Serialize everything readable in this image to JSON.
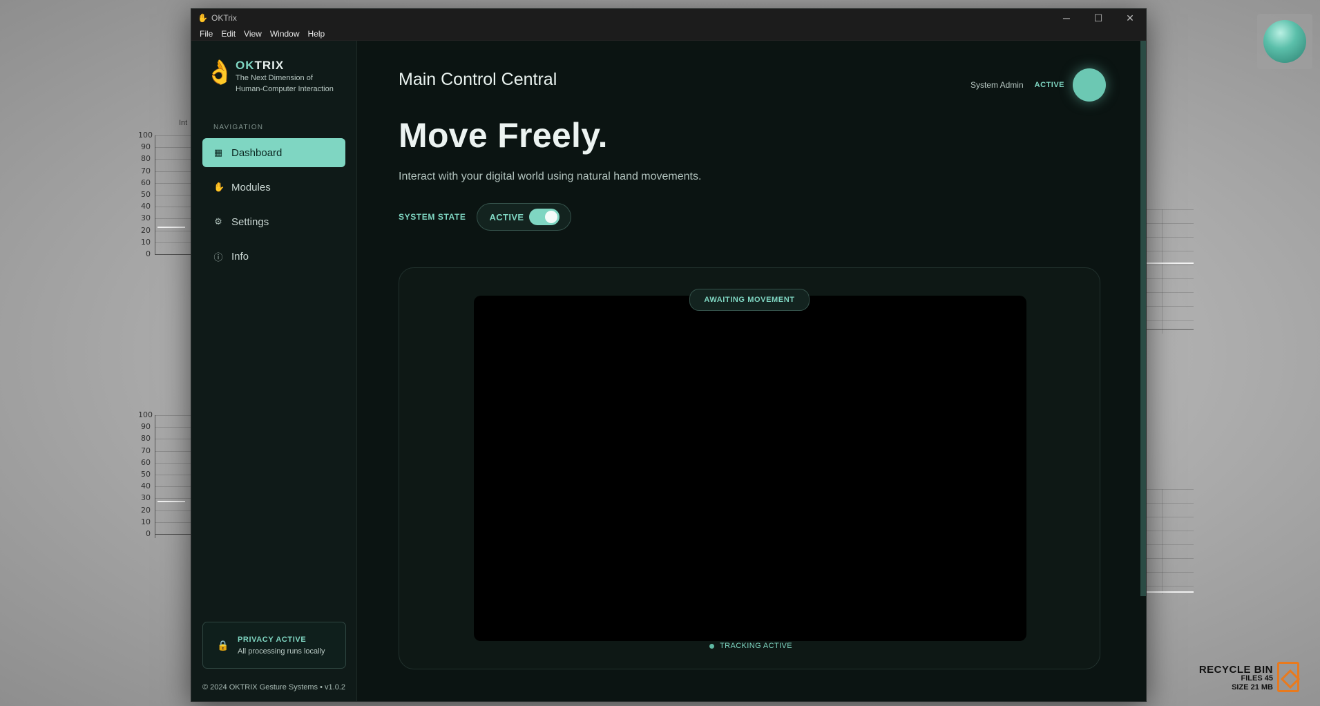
{
  "desktop": {
    "chart1": {
      "title": "Int",
      "yticks": [
        "100",
        "90",
        "80",
        "70",
        "60",
        "50",
        "40",
        "30",
        "20",
        "10",
        "0"
      ]
    },
    "chart2": {
      "yticks": [
        "100",
        "90",
        "80",
        "70",
        "60",
        "50",
        "40",
        "30",
        "20",
        "10",
        "0"
      ]
    },
    "recycle_bin": {
      "title": "RECYCLE BIN",
      "files": "FILES 45",
      "size": "SIZE 21 MB"
    }
  },
  "window": {
    "title": "OKTrix",
    "controls": {
      "minimize": "─",
      "maximize": "☐",
      "close": "✕"
    }
  },
  "menu": [
    "File",
    "Edit",
    "View",
    "Window",
    "Help"
  ],
  "sidebar": {
    "brand": {
      "ok": "OK",
      "trix": "TRIX",
      "tagline1": "The Next Dimension of",
      "tagline2": "Human-Computer Interaction"
    },
    "nav_heading": "NAVIGATION",
    "items": [
      {
        "label": "Dashboard",
        "icon": "grid-icon",
        "glyph": "▦"
      },
      {
        "label": "Modules",
        "icon": "hand-icon",
        "glyph": "✋"
      },
      {
        "label": "Settings",
        "icon": "gear-icon",
        "glyph": "⚙"
      },
      {
        "label": "Info",
        "icon": "info-icon",
        "glyph": "ⓘ"
      }
    ],
    "active_item": "Dashboard",
    "privacy": {
      "title": "PRIVACY ACTIVE",
      "subtitle": "All processing runs locally"
    },
    "copyright": "© 2024 OKTRIX Gesture Systems • v1.0.2"
  },
  "header": {
    "title": "Main Control Central",
    "user_name": "System Admin",
    "user_status": "ACTIVE"
  },
  "main": {
    "hero": "Move Freely.",
    "subtitle": "Interact with your digital world using natural hand movements.",
    "system_state_label": "SYSTEM STATE",
    "system_state_value": "ACTIVE",
    "system_state_on": true,
    "camera": {
      "status_badge": "AWAITING MOVEMENT",
      "tracking_label": "TRACKING ACTIVE"
    }
  },
  "colors": {
    "accent": "#7fd6c2",
    "window_bg": "#0c1513",
    "sidebar_bg": "#0f1a18"
  }
}
